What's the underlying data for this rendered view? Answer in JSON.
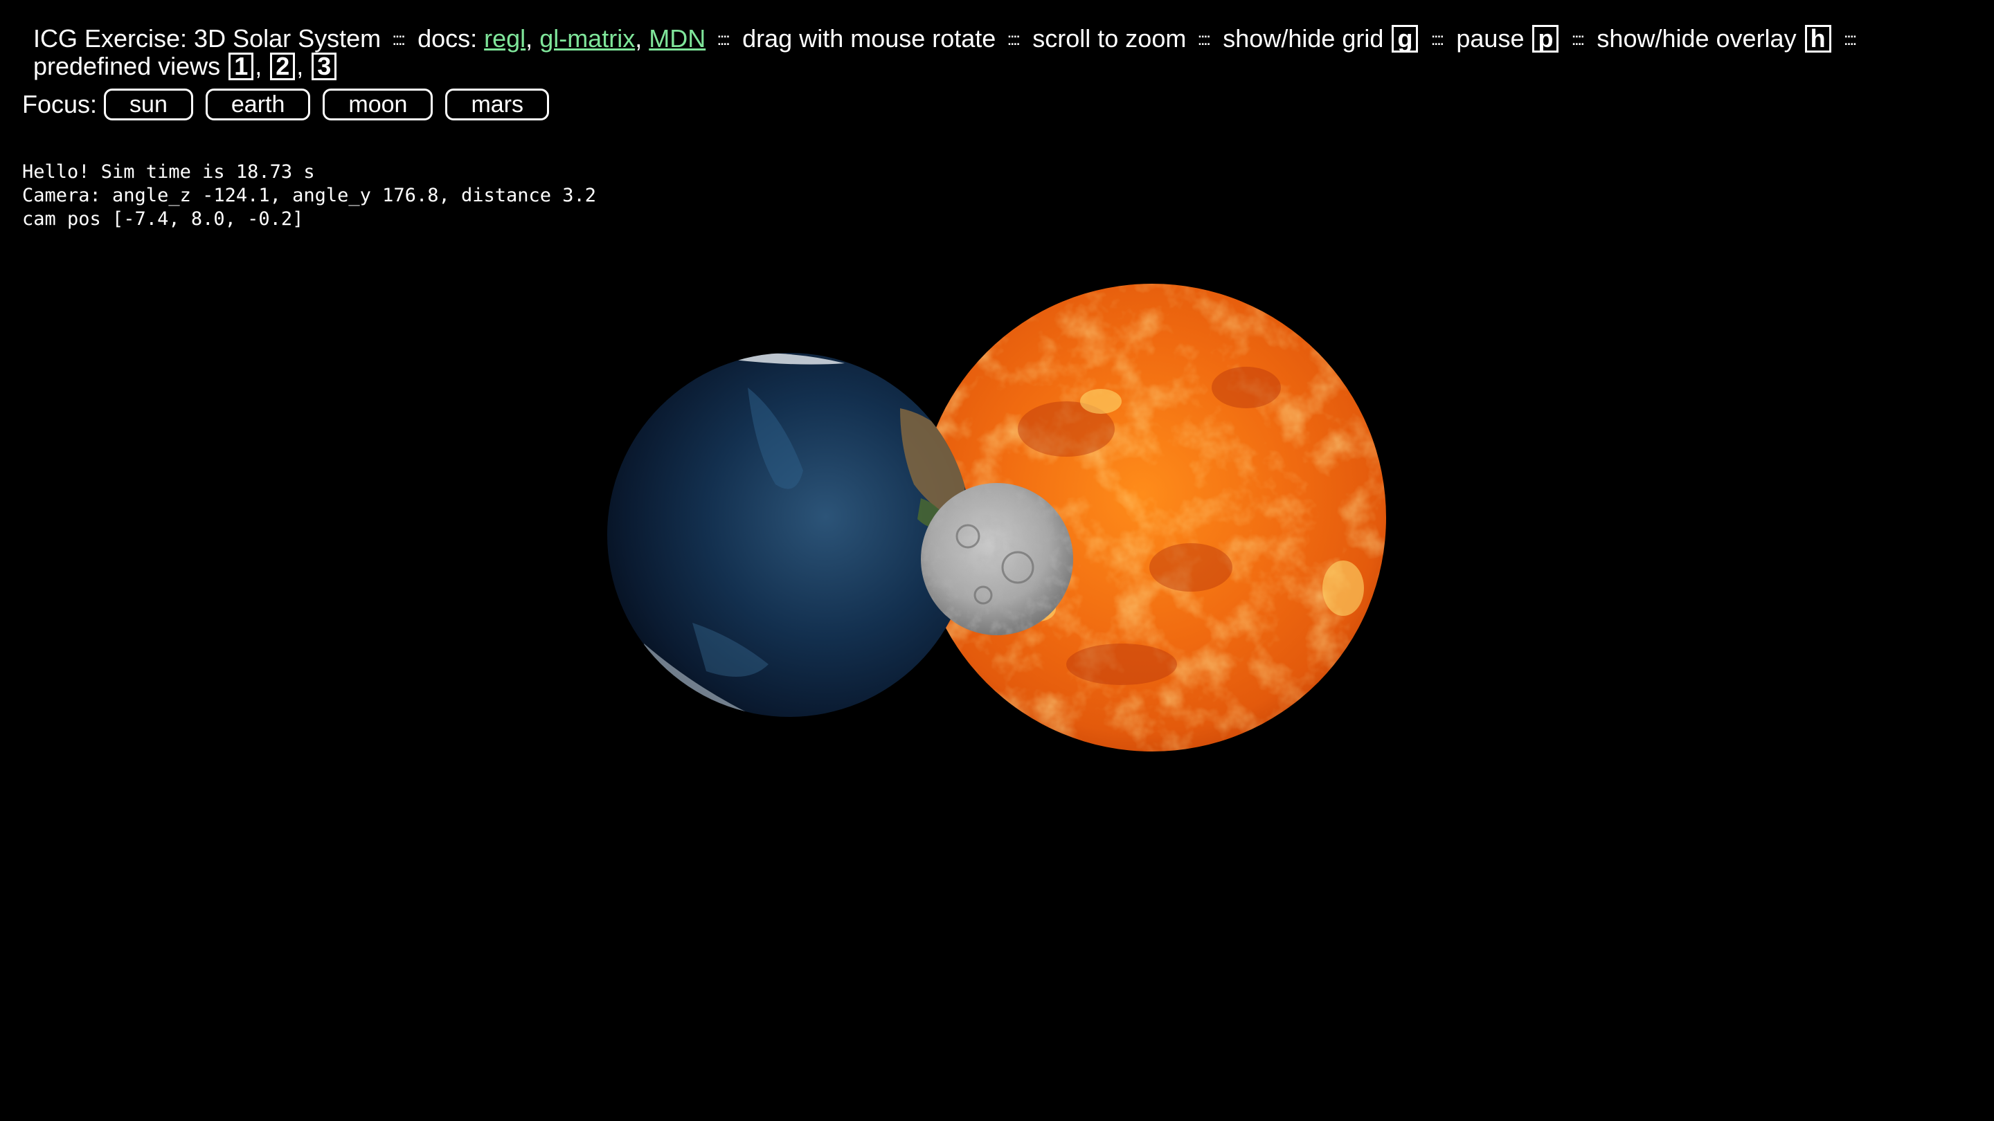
{
  "header": {
    "title": "ICG Exercise: 3D Solar System",
    "separator": "::::",
    "docs_label": "docs:",
    "links": [
      {
        "label": "regl"
      },
      {
        "label": "gl-matrix"
      },
      {
        "label": "MDN"
      }
    ],
    "drag_text": "drag with mouse rotate",
    "scroll_text": "scroll to zoom",
    "grid_text": "show/hide grid",
    "grid_key": "g",
    "pause_text": "pause",
    "pause_key": "p",
    "overlay_text": "show/hide overlay",
    "overlay_key": "h",
    "views_text": "predefined views",
    "view_keys": [
      "1",
      "2",
      "3"
    ]
  },
  "focus": {
    "label": "Focus:",
    "buttons": [
      "sun",
      "earth",
      "moon",
      "mars"
    ]
  },
  "overlay": {
    "line1": "Hello! Sim time is 18.73 s",
    "line2": "Camera: angle_z -124.1, angle_y 176.8, distance 3.2",
    "line3": "cam pos [-7.4, 8.0, -0.2]"
  },
  "colors": {
    "background": "#000000",
    "link": "#7fe59a",
    "text": "#ffffff"
  }
}
